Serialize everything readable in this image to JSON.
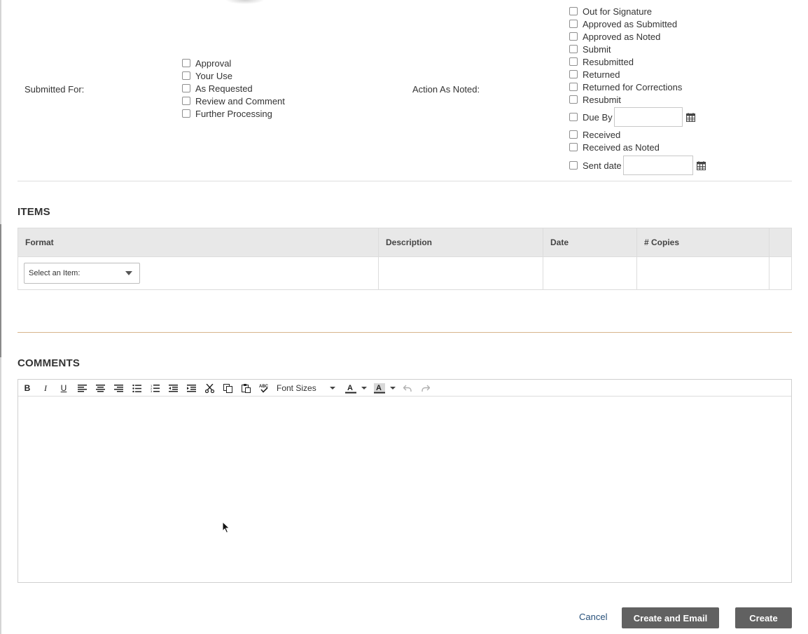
{
  "submitted_for": {
    "label": "Submitted For:",
    "options": [
      "Approval",
      "Your Use",
      "As Requested",
      "Review and Comment",
      "Further Processing"
    ]
  },
  "action_as_noted": {
    "label": "Action As Noted:",
    "options_top": [
      "Out for Signature",
      "Approved as Submitted",
      "Approved as Noted",
      "Submit",
      "Resubmitted",
      "Returned",
      "Returned for Corrections",
      "Resubmit"
    ],
    "due_by_label": "Due By",
    "options_mid": [
      "Received",
      "Received as Noted"
    ],
    "sent_date_label": "Sent date"
  },
  "items": {
    "heading": "ITEMS",
    "columns": [
      "Format",
      "Description",
      "Date",
      "# Copies"
    ],
    "select_placeholder": "Select an Item:"
  },
  "comments": {
    "heading": "COMMENTS",
    "font_sizes_label": "Font Sizes",
    "toolbar_icons": [
      "bold-icon",
      "italic-icon",
      "underline-icon",
      "align-left-icon",
      "align-center-icon",
      "align-right-icon",
      "bullet-list-icon",
      "numbered-list-icon",
      "outdent-icon",
      "indent-icon",
      "cut-icon",
      "copy-icon",
      "paste-icon",
      "spellcheck-icon",
      "text-color-icon",
      "background-color-icon",
      "undo-icon",
      "redo-icon"
    ]
  },
  "actions": {
    "cancel_label": "Cancel",
    "create_email_label": "Create and Email",
    "create_label": "Create"
  },
  "colors": {
    "button_bg": "#616161",
    "link": "#27507a",
    "orange_divider": "#d7b48c"
  }
}
